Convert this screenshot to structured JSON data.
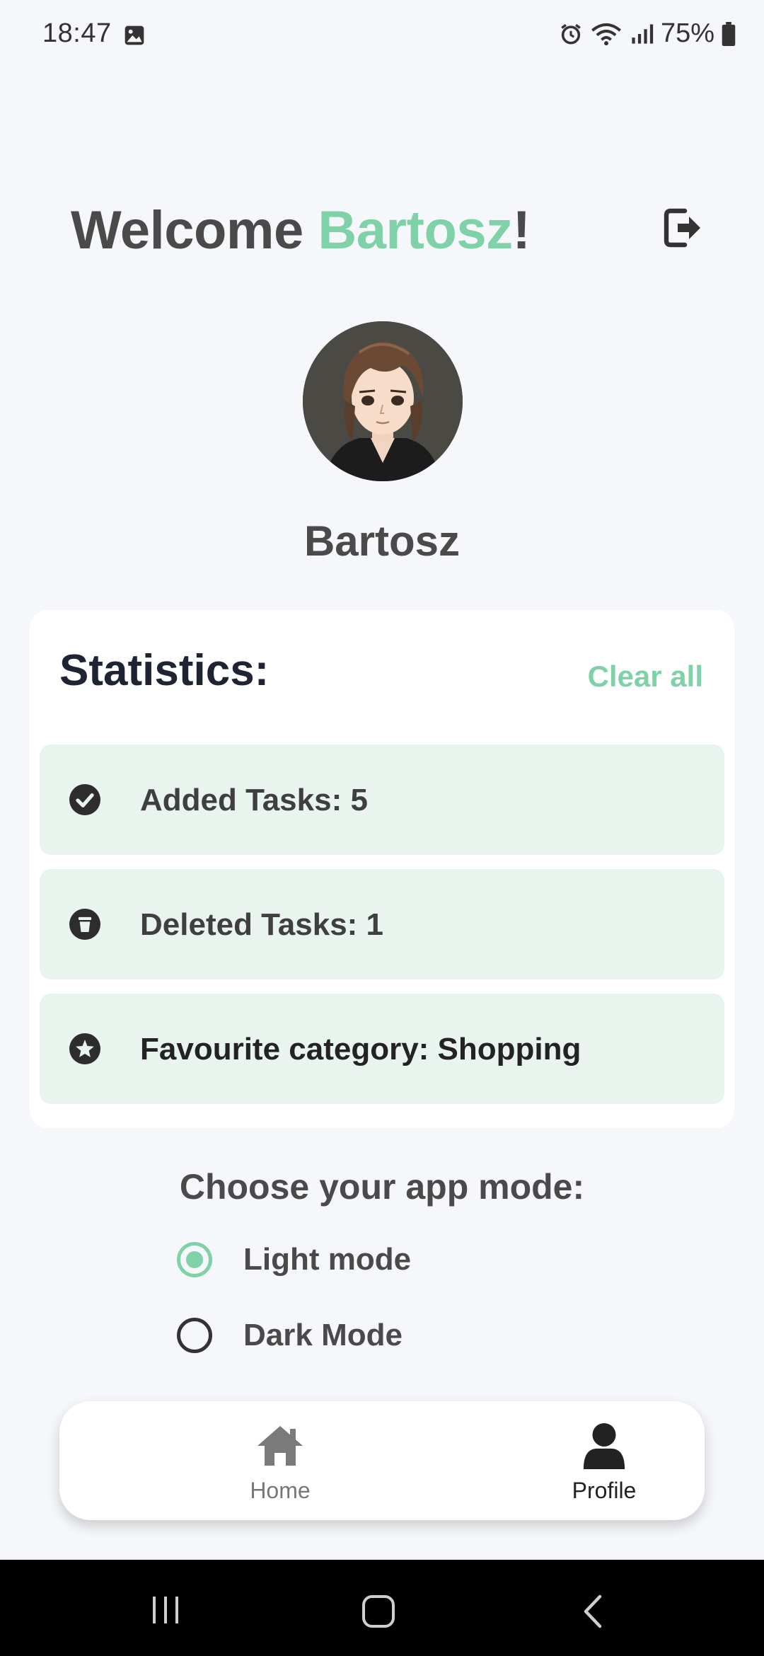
{
  "status_bar": {
    "time": "18:47",
    "battery": "75%",
    "icons": [
      "image-icon",
      "alarm-icon",
      "wifi-icon",
      "signal-icon",
      "battery-icon"
    ]
  },
  "header": {
    "welcome_prefix": "Welcome ",
    "user_name": "Bartosz",
    "welcome_suffix": "!",
    "logout_icon": "logout-icon"
  },
  "profile": {
    "name": "Bartosz"
  },
  "statistics": {
    "title": "Statistics:",
    "clear_all": "Clear all",
    "items": [
      {
        "icon": "check-circle-icon",
        "label": "Added Tasks: 5"
      },
      {
        "icon": "trash-circle-icon",
        "label": "Deleted Tasks: 1"
      },
      {
        "icon": "star-circle-icon",
        "label": "Favourite category: Shopping"
      }
    ]
  },
  "app_mode": {
    "title": "Choose your app mode:",
    "options": [
      {
        "label": "Light mode",
        "selected": true
      },
      {
        "label": "Dark Mode",
        "selected": false
      }
    ]
  },
  "bottom_nav": {
    "items": [
      {
        "icon": "home-icon",
        "label": "Home",
        "active": false
      },
      {
        "icon": "user-icon",
        "label": "Profile",
        "active": true
      }
    ]
  },
  "colors": {
    "accent": "#7fd1a8",
    "background": "#f5f7fa",
    "stat_bg": "#e9f4ef",
    "text_dark": "#1f2433"
  }
}
